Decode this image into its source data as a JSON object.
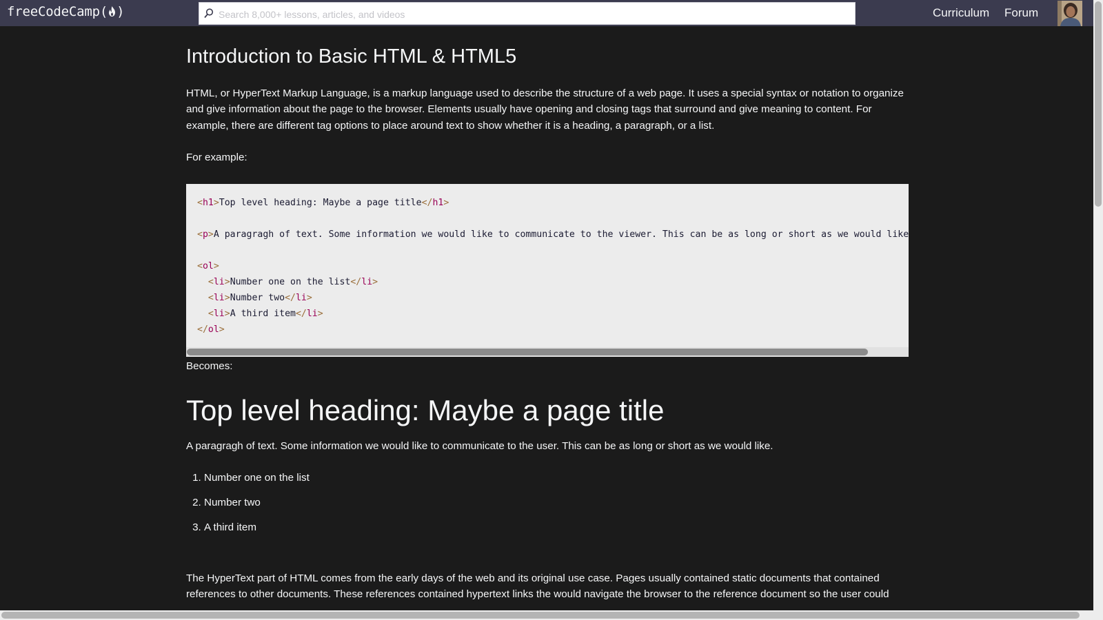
{
  "navbar": {
    "logo_text": "freeCodeCamp(",
    "logo_close": ")",
    "search_placeholder": "Search 8,000+ lessons, articles, and videos",
    "links": [
      "Curriculum",
      "Forum"
    ]
  },
  "article": {
    "title": "Introduction to Basic HTML & HTML5",
    "intro": "HTML, or HyperText Markup Language, is a markup language used to describe the structure of a web page. It uses a special syntax or notation to organize and give information about the page to the browser. Elements usually have opening and closing tags that surround and give meaning to content. For example, there are different tag options to place around text to show whether it is a heading, a paragraph, or a list.",
    "for_example": "For example:",
    "code": {
      "h1_text": "Top level heading: Maybe a page title",
      "p_text": "A paragragh of text. Some information we would like to communicate to the viewer. This can be as long or short as we would like.",
      "li_1": "Number one on the list",
      "li_2": "Number two",
      "li_3": "A third item"
    },
    "becomes": "Becomes:",
    "rendered_heading": "Top level heading: Maybe a page title",
    "rendered_paragraph": "A paragragh of text. Some information we would like to communicate to the user. This can be as long or short as we would like.",
    "rendered_list": [
      "Number one on the list",
      "Number two",
      "A third item"
    ],
    "hypertext_paragraph": "The HyperText part of HTML comes from the early days of the web and its original use case. Pages usually contained static documents that contained references to other documents. These references contained hypertext links the would navigate the browser to the reference document so the user could"
  },
  "colors": {
    "navbar_bg": "#3b3b4f",
    "page_bg": "#1b1b1b",
    "code_bg": "#ececec"
  }
}
